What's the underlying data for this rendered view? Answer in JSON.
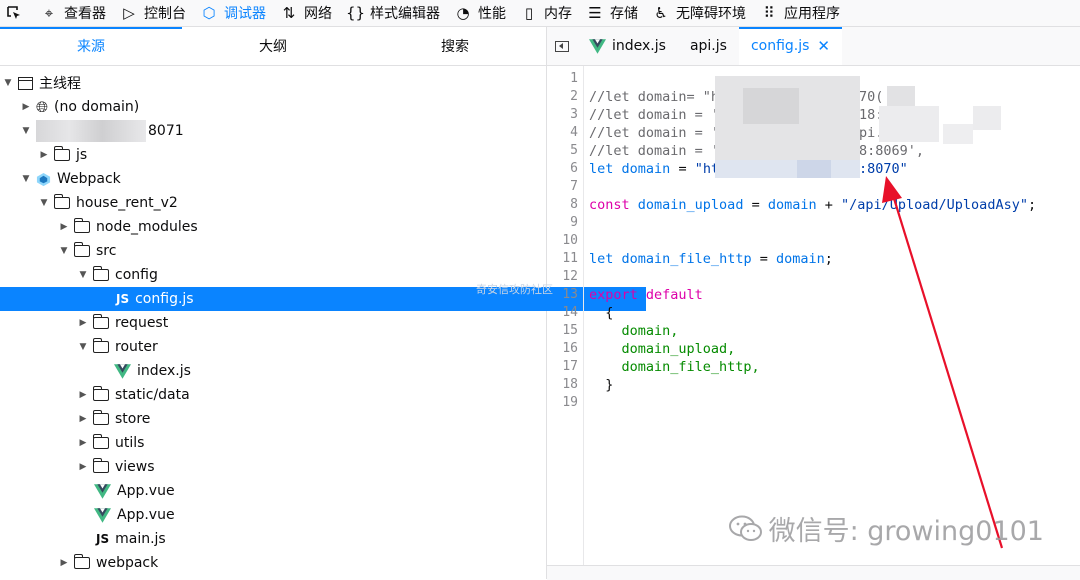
{
  "toolbar": {
    "items": [
      {
        "label": "查看器",
        "icon": "inspector-icon"
      },
      {
        "label": "控制台",
        "icon": "console-icon"
      },
      {
        "label": "调试器",
        "icon": "debugger-icon",
        "active": true
      },
      {
        "label": "网络",
        "icon": "network-icon"
      },
      {
        "label": "样式编辑器",
        "icon": "style-editor-icon"
      },
      {
        "label": "性能",
        "icon": "performance-icon"
      },
      {
        "label": "内存",
        "icon": "memory-icon"
      },
      {
        "label": "存储",
        "icon": "storage-icon"
      },
      {
        "label": "无障碍环境",
        "icon": "accessibility-icon"
      },
      {
        "label": "应用程序",
        "icon": "application-icon"
      }
    ]
  },
  "left_tabs": [
    "来源",
    "大纲",
    "搜索"
  ],
  "tree": {
    "main_thread": "主线程",
    "no_domain": "(no domain)",
    "host_suffix": "8071",
    "js": "js",
    "webpack": "Webpack",
    "project": "house_rent_v2",
    "node_modules": "node_modules",
    "src": "src",
    "config": "config",
    "config_js": "config.js",
    "request": "request",
    "router": "router",
    "index_js": "index.js",
    "static_data": "static/data",
    "store": "store",
    "utils": "utils",
    "views": "views",
    "app_vue_1": "App.vue",
    "app_vue_2": "App.vue",
    "main_js": "main.js",
    "webpack_folder": "webpack",
    "js_icon_text": "JS"
  },
  "editor_tabs": {
    "tab1": "index.js",
    "tab2": "api.js",
    "tab3": "config.js",
    "close": "✕"
  },
  "code": {
    "line_numbers": [
      "1",
      "2",
      "3",
      "4",
      "5",
      "6",
      "7",
      "8",
      "9",
      "10",
      "11",
      "12",
      "13",
      "14",
      "15",
      "16",
      "17",
      "18",
      "19"
    ],
    "l2": "//let domain= \"h",
    "l2b": "70(",
    "l3": "//let domain = '",
    "l3b": "18:",
    "l4": "//let domain = '",
    "l4b": "pi.",
    "l5": "//let domain = '",
    "l5b": "8:8069',",
    "l6_kw": "let",
    "l6_var": "domain",
    "l6_eq": " = ",
    "l6_str": "\"ht",
    "l6_str2": ":8070\"",
    "l8_kw": "const",
    "l8_var": "domain_upload",
    "l8_eq": " = ",
    "l8_var2": "domain",
    "l8_plus": " + ",
    "l8_str": "\"/api/Upload/UploadAsy\"",
    "l8_end": ";",
    "l11_kw": "let",
    "l11_var": "domain_file_http",
    "l11_eq": " = ",
    "l11_var2": "domain",
    "l11_end": ";",
    "l13": "export default",
    "l14": "  {",
    "l15": "    domain,",
    "l16": "    domain_upload,",
    "l17": "    domain_file_http,",
    "l18": "  }"
  },
  "watermark": "微信号: growing0101",
  "center_watermark": "奇安信攻防社区",
  "colors": {
    "accent": "#0a84ff",
    "keyword": "#dd00a9",
    "string": "#003eaa",
    "variable": "#0074e8",
    "annotation": "#e8102a"
  }
}
